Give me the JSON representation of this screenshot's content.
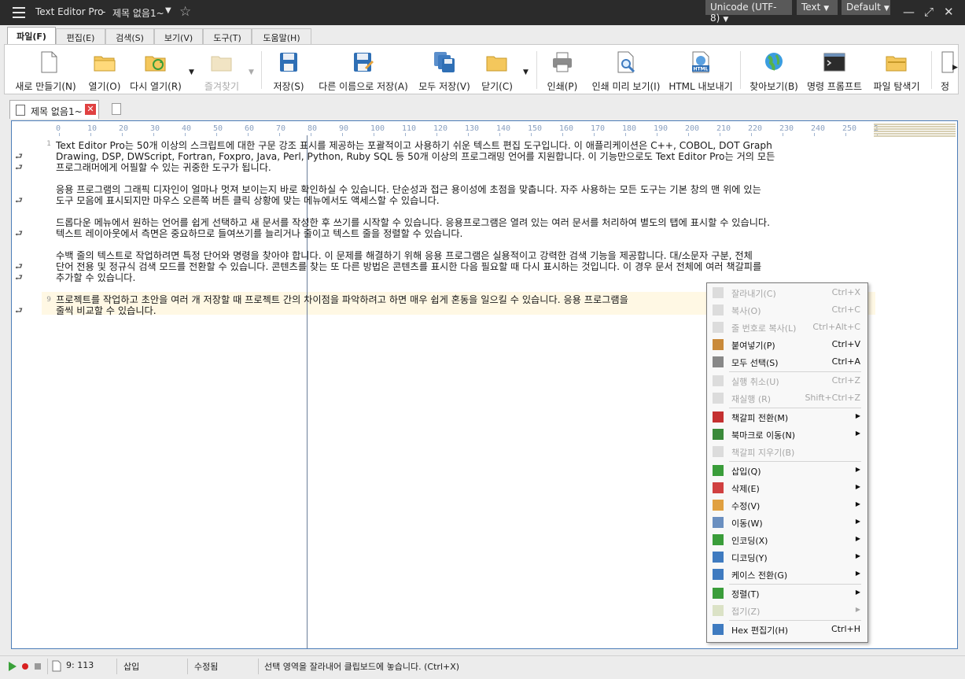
{
  "titlebar": {
    "app_name": "Text Editor Pro",
    "separator": "-",
    "document_title": "제목 없음1~",
    "encoding": "Unicode (UTF-8)",
    "syntax": "Text",
    "theme": "Default"
  },
  "ribbon_tabs": [
    "파일(F)",
    "편집(E)",
    "검색(S)",
    "보기(V)",
    "도구(T)",
    "도움말(H)"
  ],
  "ribbon": {
    "new": "새로 만들기(N)",
    "open": "열기(O)",
    "reopen": "다시 열기(R)",
    "favorites": "즐겨찾기",
    "save": "저장(S)",
    "save_as": "다른 이름으로 저장(A)",
    "save_all": "모두 저장(V)",
    "close": "닫기(C)",
    "print": "인쇄(P)",
    "print_preview": "인쇄 미리 보기(I)",
    "html_export": "HTML 내보내기",
    "html_badge": "HTML",
    "browse": "찾아보기(B)",
    "command_prompt": "명령 프롬프트",
    "file_explorer": "파일 탐색기",
    "overflow": "정"
  },
  "doc_tab": {
    "name": "제목 없음1~",
    "close_glyph": "✕"
  },
  "ruler": [
    "0",
    "10",
    "20",
    "30",
    "40",
    "50",
    "60",
    "70",
    "80",
    "90",
    "100",
    "110",
    "120",
    "130",
    "140",
    "150",
    "160",
    "170",
    "180",
    "190",
    "200",
    "210",
    "220",
    "230",
    "240",
    "250",
    "2"
  ],
  "gutter": {
    "line1": "1",
    "line9": "9",
    "wrap_glyph": "⮐"
  },
  "text_lines": [
    "Text Editor Pro는 50개 이상의 스크립트에 대한 구문 강조 표시를 제공하는 포괄적이고 사용하기 쉬운 텍스트 편집 도구입니다. 이 애플리케이션은 C++, COBOL, DOT Graph",
    "Drawing, DSP, DWScript, Fortran, Foxpro, Java, Perl, Python, Ruby SQL 등 50개 이상의 프로그래밍 언어를 지원합니다. 이 기능만으로도 Text Editor Pro는 거의 모든",
    "프로그래머에게 어필할 수 있는 귀중한 도구가 됩니다.",
    "응용 프로그램의 그래픽 디자인이 얼마나 멋져 보이는지 바로 확인하실 수 있습니다. 단순성과 접근 용이성에 초점을 맞춥니다. 자주 사용하는 모든 도구는 기본 창의 맨 위에 있는",
    "도구 모음에 표시되지만 마우스 오른쪽 버튼 클릭 상황에 맞는 메뉴에서도 액세스할 수 있습니다.",
    "드롭다운 메뉴에서 원하는 언어를 쉽게 선택하고 새 문서를 작성한 후 쓰기를 시작할 수 있습니다. 응용프로그램은 열려 있는 여러 문서를 처리하여 별도의 탭에 표시할 수 있습니다.",
    " 텍스트 레이아웃에서 측면은 중요하므로 들여쓰기를 늘리거나 줄이고 텍스트 줄을 정렬할 수 있습니다.",
    "수백 줄의 텍스트로 작업하려면 특정 단어와 명령을 찾아야 합니다. 이 문제를 해결하기 위해 응용 프로그램은 실용적이고 강력한 검색 기능을 제공합니다. 대/소문자 구분, 전체",
    "단어 전용 및 정규식 검색 모드를 전환할 수 있습니다. 콘텐츠를 찾는 또 다른 방법은 콘텐츠를 표시한 다음 필요할 때 다시 표시하는 것입니다. 이 경우 문서 전체에 여러 책갈피를",
    "추가할 수 있습니다.",
    "프로젝트를 작업하고 초안을 여러 개 저장할 때 프로젝트 간의 차이점을 파악하려고 하면 매우 쉽게 혼동을 일으킬 수 있습니다. 응용 프로그램을",
    "줄씩 비교할 수 있습니다."
  ],
  "context_menu": [
    {
      "label": "잘라내기(C)",
      "shortcut": "Ctrl+X",
      "disabled": true
    },
    {
      "label": "복사(O)",
      "shortcut": "Ctrl+C",
      "disabled": true
    },
    {
      "label": "줄 번호로 복사(L)",
      "shortcut": "Ctrl+Alt+C",
      "disabled": true
    },
    {
      "label": "붙여넣기(P)",
      "shortcut": "Ctrl+V",
      "disabled": false
    },
    {
      "label": "모두 선택(S)",
      "shortcut": "Ctrl+A",
      "disabled": false
    },
    {
      "label": "실행 취소(U)",
      "shortcut": "Ctrl+Z",
      "disabled": true
    },
    {
      "label": "재실행 (R)",
      "shortcut": "Shift+Ctrl+Z",
      "disabled": true
    },
    {
      "label": "책갈피 전환(M)",
      "shortcut": "",
      "disabled": false
    },
    {
      "label": "북마크로 이동(N)",
      "shortcut": "",
      "disabled": false
    },
    {
      "label": "책갈피 지우기(B)",
      "shortcut": "",
      "disabled": true
    },
    {
      "label": "삽입(Q)",
      "shortcut": "",
      "disabled": false
    },
    {
      "label": "삭제(E)",
      "shortcut": "",
      "disabled": false
    },
    {
      "label": "수정(V)",
      "shortcut": "",
      "disabled": false
    },
    {
      "label": "이동(W)",
      "shortcut": "",
      "disabled": false
    },
    {
      "label": "인코딩(X)",
      "shortcut": "",
      "disabled": false
    },
    {
      "label": "디코딩(Y)",
      "shortcut": "",
      "disabled": false
    },
    {
      "label": "케이스 전환(G)",
      "shortcut": "",
      "disabled": false
    },
    {
      "label": "정렬(T)",
      "shortcut": "",
      "disabled": false
    },
    {
      "label": "접기(Z)",
      "shortcut": "",
      "disabled": true
    },
    {
      "label": "Hex 편집기(H)",
      "shortcut": "Ctrl+H",
      "disabled": false
    }
  ],
  "status": {
    "position": "9: 113",
    "mode": "삽입",
    "modified": "수정됨",
    "hint": "선택 영역을 잘라내어 클립보드에 놓습니다. (Ctrl+X)"
  },
  "colors": {
    "titlebar_bg": "#2b2b2b",
    "editor_border": "#4d7db8",
    "current_line": "#fff8e4",
    "close_red": "#e04141",
    "play_green": "#3aa13a",
    "record_red": "#d82020"
  }
}
